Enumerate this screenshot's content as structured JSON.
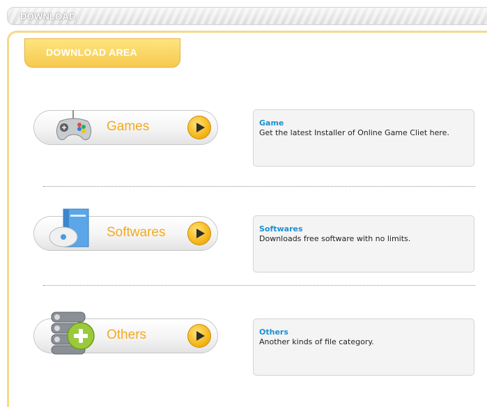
{
  "header": {
    "title": "DOWNLOAD"
  },
  "tab": {
    "label": "DOWNLOAD AREA"
  },
  "categories": [
    {
      "label": "Games",
      "icon": "gamepad-icon",
      "info_title": "Game",
      "info_text": "Get the latest Installer of Online Game Cliet here."
    },
    {
      "label": "Softwares",
      "icon": "software-box-icon",
      "info_title": "Softwares",
      "info_text": "Downloads free software with no limits."
    },
    {
      "label": "Others",
      "icon": "server-add-icon",
      "info_title": "Others",
      "info_text": "Another kinds of file category."
    }
  ],
  "colors": {
    "accent": "#f4a91e",
    "info_title": "#1b8fd3",
    "frame": "#f7d98b"
  }
}
